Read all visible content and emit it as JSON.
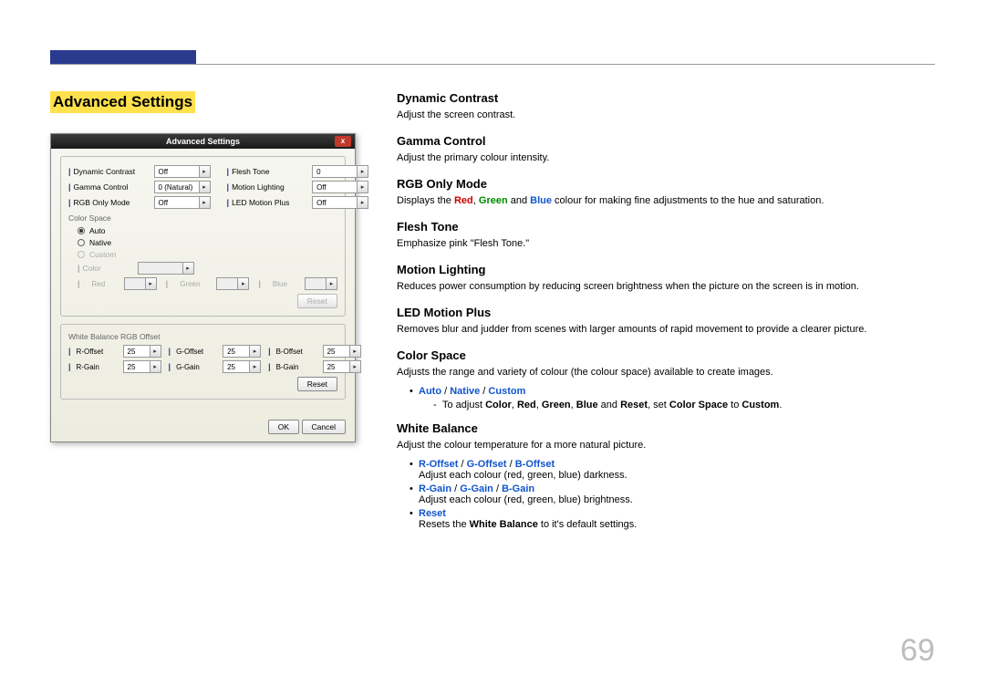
{
  "page_number": "69",
  "section_title": "Advanced Settings",
  "dialog": {
    "title": "Advanced Settings",
    "close_label": "x",
    "top_fields": {
      "dynamic_contrast": {
        "label": "Dynamic Contrast",
        "value": "Off"
      },
      "gamma_control": {
        "label": "Gamma Control",
        "value": "0 (Natural)"
      },
      "rgb_only_mode": {
        "label": "RGB Only Mode",
        "value": "Off"
      },
      "flesh_tone": {
        "label": "Flesh Tone",
        "value": "0"
      },
      "motion_lighting": {
        "label": "Motion Lighting",
        "value": "Off"
      },
      "led_motion_plus": {
        "label": "LED Motion Plus",
        "value": "Off"
      }
    },
    "color_space": {
      "group_label": "Color Space",
      "auto": "Auto",
      "native": "Native",
      "custom": "Custom",
      "color_label": "Color",
      "color_value": "",
      "red_label": "Red",
      "green_label": "Green",
      "blue_label": "Blue",
      "reset": "Reset"
    },
    "white_balance": {
      "group_label": "White Balance RGB Offset",
      "r_offset": {
        "label": "R-Offset",
        "value": "25"
      },
      "g_offset": {
        "label": "G-Offset",
        "value": "25"
      },
      "b_offset": {
        "label": "B-Offset",
        "value": "25"
      },
      "r_gain": {
        "label": "R-Gain",
        "value": "25"
      },
      "g_gain": {
        "label": "G-Gain",
        "value": "25"
      },
      "b_gain": {
        "label": "B-Gain",
        "value": "25"
      },
      "reset": "Reset"
    },
    "buttons": {
      "ok": "OK",
      "cancel": "Cancel"
    }
  },
  "desc": {
    "dynamic_contrast": {
      "h": "Dynamic Contrast",
      "p": "Adjust the screen contrast."
    },
    "gamma_control": {
      "h": "Gamma Control",
      "p": "Adjust the primary colour intensity."
    },
    "rgb_only_mode": {
      "h": "RGB Only Mode",
      "pre": "Displays the ",
      "red": "Red",
      "c1": ", ",
      "green": "Green",
      "c2": " and ",
      "blue": "Blue",
      "post": " colour for making fine adjustments to the hue and saturation."
    },
    "flesh_tone": {
      "h": "Flesh Tone",
      "p": "Emphasize pink \"Flesh Tone.\""
    },
    "motion_lighting": {
      "h": "Motion Lighting",
      "p": "Reduces power consumption by reducing screen brightness when the picture on the screen is in motion."
    },
    "led_motion_plus": {
      "h": "LED Motion Plus",
      "p": "Removes blur and judder from scenes with larger amounts of rapid movement to provide a clearer picture."
    },
    "color_space": {
      "h": "Color Space",
      "p": "Adjusts the range and variety of colour (the colour space) available to create images.",
      "opts": {
        "auto": "Auto",
        "sep": " / ",
        "native": "Native",
        "custom": "Custom"
      },
      "sub_pre": "To adjust ",
      "sub_color": "Color",
      "sub_c1": ", ",
      "sub_red": "Red",
      "sub_c2": ", ",
      "sub_green": "Green",
      "sub_c3": ", ",
      "sub_blue": "Blue",
      "sub_and": " and ",
      "sub_reset": "Reset",
      "sub_mid": ", set ",
      "sub_colorspace": "Color Space",
      "sub_to": " to ",
      "sub_custom": "Custom",
      "sub_dot": "."
    },
    "white_balance": {
      "h": "White Balance",
      "p": "Adjust the colour temperature for a more natural picture.",
      "offset": {
        "r": "R-Offset",
        "sep": " / ",
        "g": "G-Offset",
        "b": "B-Offset",
        "d": "Adjust each colour (red, green, blue) darkness."
      },
      "gain": {
        "r": "R-Gain",
        "sep": " / ",
        "g": "G-Gain",
        "b": "B-Gain",
        "d": "Adjust each colour (red, green, blue) brightness."
      },
      "reset": {
        "label": "Reset",
        "d_pre": "Resets the ",
        "d_wb": "White Balance",
        "d_post": " to it's default settings."
      }
    }
  }
}
